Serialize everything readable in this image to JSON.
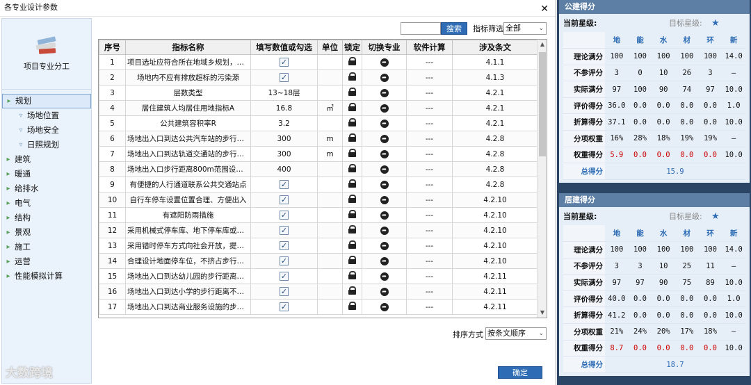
{
  "dialog": {
    "title": "各专业设计参数",
    "close": "✕",
    "left_header": "项目专业分工",
    "tree": [
      {
        "label": "规划",
        "level": 0,
        "selected": true
      },
      {
        "label": "场地位置",
        "level": 1
      },
      {
        "label": "场地安全",
        "level": 1
      },
      {
        "label": "日照规划",
        "level": 1
      },
      {
        "label": "建筑",
        "level": 0
      },
      {
        "label": "暖通",
        "level": 0
      },
      {
        "label": "给排水",
        "level": 0
      },
      {
        "label": "电气",
        "level": 0
      },
      {
        "label": "结构",
        "level": 0
      },
      {
        "label": "景观",
        "level": 0
      },
      {
        "label": "施工",
        "level": 0
      },
      {
        "label": "运营",
        "level": 0
      },
      {
        "label": "性能模拟计算",
        "level": 0
      }
    ],
    "search_value": "",
    "search_button": "搜索",
    "filter_label": "指标筛选",
    "filter_value": "全部",
    "table": {
      "columns": [
        "序号",
        "指标名称",
        "填写数值或勾选",
        "单位",
        "锁定",
        "切换专业",
        "软件计算",
        "涉及条文"
      ],
      "rows": [
        {
          "no": "1",
          "name": "项目选址应符合所在地域乡规划，项...",
          "value": "check",
          "unit": "",
          "calc": "---",
          "clause": "4.1.1"
        },
        {
          "no": "2",
          "name": "场地内不应有排放超标的污染源",
          "value": "check",
          "unit": "",
          "calc": "---",
          "clause": "4.1.3"
        },
        {
          "no": "3",
          "name": "层数类型",
          "value": "13~18层",
          "unit": "",
          "calc": "---",
          "clause": "4.2.1"
        },
        {
          "no": "4",
          "name": "居住建筑人均居住用地指标A",
          "value": "16.8",
          "unit": "㎡",
          "calc": "---",
          "clause": "4.2.1"
        },
        {
          "no": "5",
          "name": "公共建筑容积率R",
          "value": "3.2",
          "unit": "",
          "calc": "---",
          "clause": "4.2.1"
        },
        {
          "no": "6",
          "name": "场地出入口到达公共汽车站的步行距...",
          "value": "300",
          "unit": "m",
          "calc": "---",
          "clause": "4.2.8"
        },
        {
          "no": "7",
          "name": "场地出入口到达轨道交通站的步行距...",
          "value": "300",
          "unit": "m",
          "calc": "---",
          "clause": "4.2.8"
        },
        {
          "no": "8",
          "name": "场地出入口步行距离800m范围设有...",
          "value": "400",
          "unit": "",
          "calc": "---",
          "clause": "4.2.8"
        },
        {
          "no": "9",
          "name": "有便捷的人行通道联系公共交通站点",
          "value": "check",
          "unit": "",
          "calc": "---",
          "clause": "4.2.8"
        },
        {
          "no": "10",
          "name": "自行车停车设置位置合理、方便出入",
          "value": "check",
          "unit": "",
          "calc": "---",
          "clause": "4.2.10"
        },
        {
          "no": "11",
          "name": "有遮阳防雨措施",
          "value": "check",
          "unit": "",
          "calc": "---",
          "clause": "4.2.10"
        },
        {
          "no": "12",
          "name": "采用机械式停车库、地下停车库或停...",
          "value": "check",
          "unit": "",
          "calc": "---",
          "clause": "4.2.10"
        },
        {
          "no": "13",
          "name": "采用错时停车方式向社会开放，提高...",
          "value": "check",
          "unit": "",
          "calc": "---",
          "clause": "4.2.10"
        },
        {
          "no": "14",
          "name": "合理设计地面停车位，不挤占步行空...",
          "value": "check",
          "unit": "",
          "calc": "---",
          "clause": "4.2.10"
        },
        {
          "no": "15",
          "name": "场地出入口到达幼儿园的步行距离不...",
          "value": "check",
          "unit": "",
          "calc": "---",
          "clause": "4.2.11"
        },
        {
          "no": "16",
          "name": "场地出入口到达小学的步行距离不大...",
          "value": "check",
          "unit": "",
          "calc": "---",
          "clause": "4.2.11"
        },
        {
          "no": "17",
          "name": "场地出入口到达商业服务设施的步行...",
          "value": "check",
          "unit": "",
          "calc": "---",
          "clause": "4.2.11"
        }
      ]
    },
    "sort_label": "排序方式",
    "sort_value": "按条文顺序",
    "ok_button": "确定",
    "watermark": "大数跨境"
  },
  "panels": [
    {
      "title": "公建得分",
      "current_star_label": "当前星级:",
      "target_star_label": "目标星级:",
      "target_star": "★",
      "headers": [
        "地",
        "能",
        "水",
        "材",
        "环",
        "新"
      ],
      "rows": [
        {
          "label": "理论满分",
          "values": [
            "100",
            "100",
            "100",
            "100",
            "100",
            "14.0"
          ]
        },
        {
          "label": "不参评分",
          "values": [
            "3",
            "0",
            "10",
            "26",
            "3",
            "—"
          ]
        },
        {
          "label": "实际满分",
          "values": [
            "97",
            "100",
            "90",
            "74",
            "97",
            "10.0"
          ]
        },
        {
          "label": "评价得分",
          "values": [
            "36.0",
            "0.0",
            "0.0",
            "0.0",
            "0.0",
            "1.0"
          ]
        },
        {
          "label": "折算得分",
          "values": [
            "37.1",
            "0.0",
            "0.0",
            "0.0",
            "0.0",
            "10.0"
          ]
        },
        {
          "label": "分项权重",
          "values": [
            "16%",
            "28%",
            "18%",
            "19%",
            "19%",
            "—"
          ]
        },
        {
          "label": "权重得分",
          "values": [
            "5.9",
            "0.0",
            "0.0",
            "0.0",
            "0.0",
            "10.0"
          ],
          "red": true
        }
      ],
      "total_label": "总得分",
      "total_value": "15.9"
    },
    {
      "title": "居建得分",
      "current_star_label": "当前星级:",
      "target_star_label": "目标星级:",
      "target_star": "★",
      "headers": [
        "地",
        "能",
        "水",
        "材",
        "环",
        "新"
      ],
      "rows": [
        {
          "label": "理论满分",
          "values": [
            "100",
            "100",
            "100",
            "100",
            "100",
            "14.0"
          ]
        },
        {
          "label": "不参评分",
          "values": [
            "3",
            "3",
            "10",
            "25",
            "11",
            "—"
          ]
        },
        {
          "label": "实际满分",
          "values": [
            "97",
            "97",
            "90",
            "75",
            "89",
            "10.0"
          ]
        },
        {
          "label": "评价得分",
          "values": [
            "40.0",
            "0.0",
            "0.0",
            "0.0",
            "0.0",
            "1.0"
          ]
        },
        {
          "label": "折算得分",
          "values": [
            "41.2",
            "0.0",
            "0.0",
            "0.0",
            "0.0",
            "10.0"
          ]
        },
        {
          "label": "分项权重",
          "values": [
            "21%",
            "24%",
            "20%",
            "17%",
            "18%",
            "—"
          ]
        },
        {
          "label": "权重得分",
          "values": [
            "8.7",
            "0.0",
            "0.0",
            "0.0",
            "0.0",
            "10.0"
          ],
          "red": true
        }
      ],
      "total_label": "总得分",
      "total_value": "18.7"
    }
  ]
}
